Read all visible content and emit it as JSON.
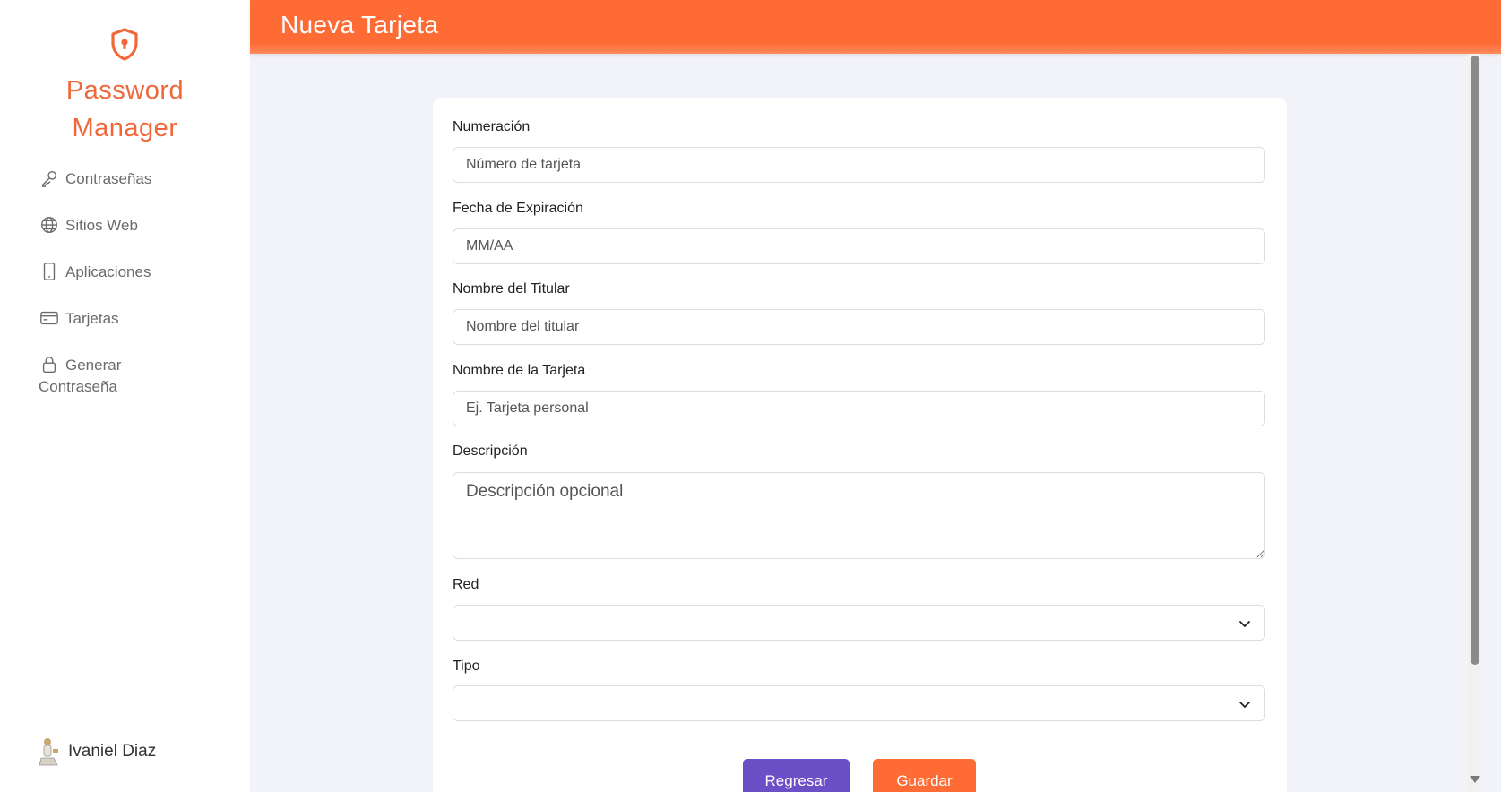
{
  "app": {
    "brand_line1": "Password",
    "brand_line2": "Manager",
    "brand_color": "#f0683a"
  },
  "sidebar": {
    "items": [
      {
        "label": "Contraseñas",
        "icon": "key-icon"
      },
      {
        "label": "Sitios Web",
        "icon": "globe-icon"
      },
      {
        "label": "Aplicaciones",
        "icon": "phone-icon"
      },
      {
        "label": "Tarjetas",
        "icon": "credit-card-icon"
      },
      {
        "label_line1": "Generar",
        "label_line2": "Contraseña",
        "icon": "lock-icon"
      }
    ],
    "user_name": "Ivaniel Diaz"
  },
  "header": {
    "title": "Nueva Tarjeta",
    "color": "#ff6b35"
  },
  "form": {
    "numeracion": {
      "label": "Numeración",
      "placeholder": "Número de tarjeta",
      "value": ""
    },
    "expiracion": {
      "label": "Fecha de Expiración",
      "placeholder": "MM/AA",
      "value": ""
    },
    "titular": {
      "label": "Nombre del Titular",
      "placeholder": "Nombre del titular",
      "value": ""
    },
    "nombre_tarjeta": {
      "label": "Nombre de la Tarjeta",
      "placeholder": "Ej. Tarjeta personal",
      "value": ""
    },
    "descripcion": {
      "label": "Descripción",
      "placeholder": "Descripción opcional",
      "value": ""
    },
    "red": {
      "label": "Red",
      "selected": ""
    },
    "tipo": {
      "label": "Tipo",
      "selected": ""
    },
    "back_label": "Regresar",
    "save_label": "Guardar",
    "back_color": "#6a4fc7",
    "save_color": "#ff6b35"
  }
}
